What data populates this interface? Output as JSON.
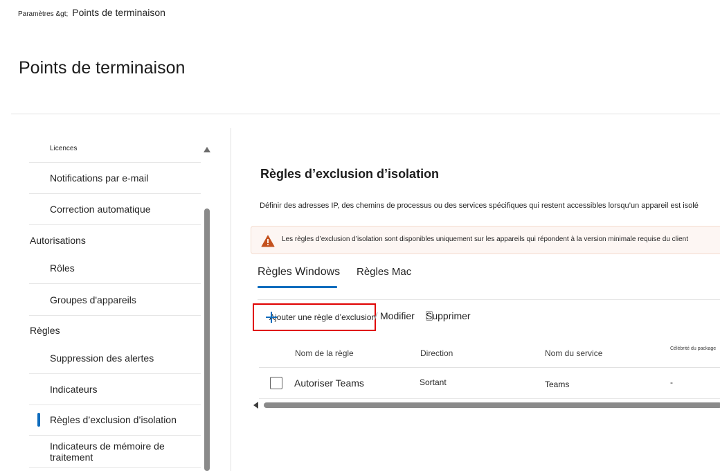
{
  "breadcrumb": {
    "parent": "Paramètres &gt;",
    "current": "Points de terminaison"
  },
  "page": {
    "title": "Points de terminaison"
  },
  "nav": {
    "items": [
      {
        "label": "Licences",
        "style": "small"
      },
      {
        "label": "Notifications par e-mail"
      },
      {
        "label": "Correction automatique"
      },
      {
        "label": "Rôles"
      },
      {
        "label": "Groupes d'appareils"
      },
      {
        "label": "Suppression des alertes"
      },
      {
        "label": "Indicateurs"
      },
      {
        "label": "Règles d’exclusion d’isolation",
        "active": true
      },
      {
        "label": "Indicateurs de mémoire de traitement"
      }
    ],
    "sections": [
      {
        "label": "Autorisations"
      },
      {
        "label": "Règles"
      }
    ]
  },
  "main": {
    "section_title": "Règles d’exclusion d’isolation",
    "description": "Définir des adresses IP, des chemins de processus ou des services spécifiques qui restent accessibles lorsqu’un appareil est isolé",
    "warning": {
      "icon": "warning-icon",
      "text": "Les règles d’exclusion d’isolation sont disponibles uniquement sur les appareils qui répondent à la version minimale requise du client"
    },
    "tabs": [
      {
        "label": "Règles Windows",
        "selected": true
      },
      {
        "label": "Règles Mac"
      }
    ],
    "toolbar": {
      "add_label": "Ajouter une règle d’exclusion",
      "edit_label": "Modifier",
      "delete_label": "Supprimer"
    },
    "table": {
      "headers": [
        "Nom de la règle",
        "Direction",
        "Nom du service",
        "Célébrité du package"
      ],
      "rows": [
        {
          "name": "Autoriser Teams",
          "direction": "Sortant",
          "service": "Teams",
          "package": "-"
        }
      ]
    }
  },
  "colors": {
    "accent": "#0f6cbd",
    "highlight_border": "#e00000",
    "warning": "#c4521f"
  }
}
